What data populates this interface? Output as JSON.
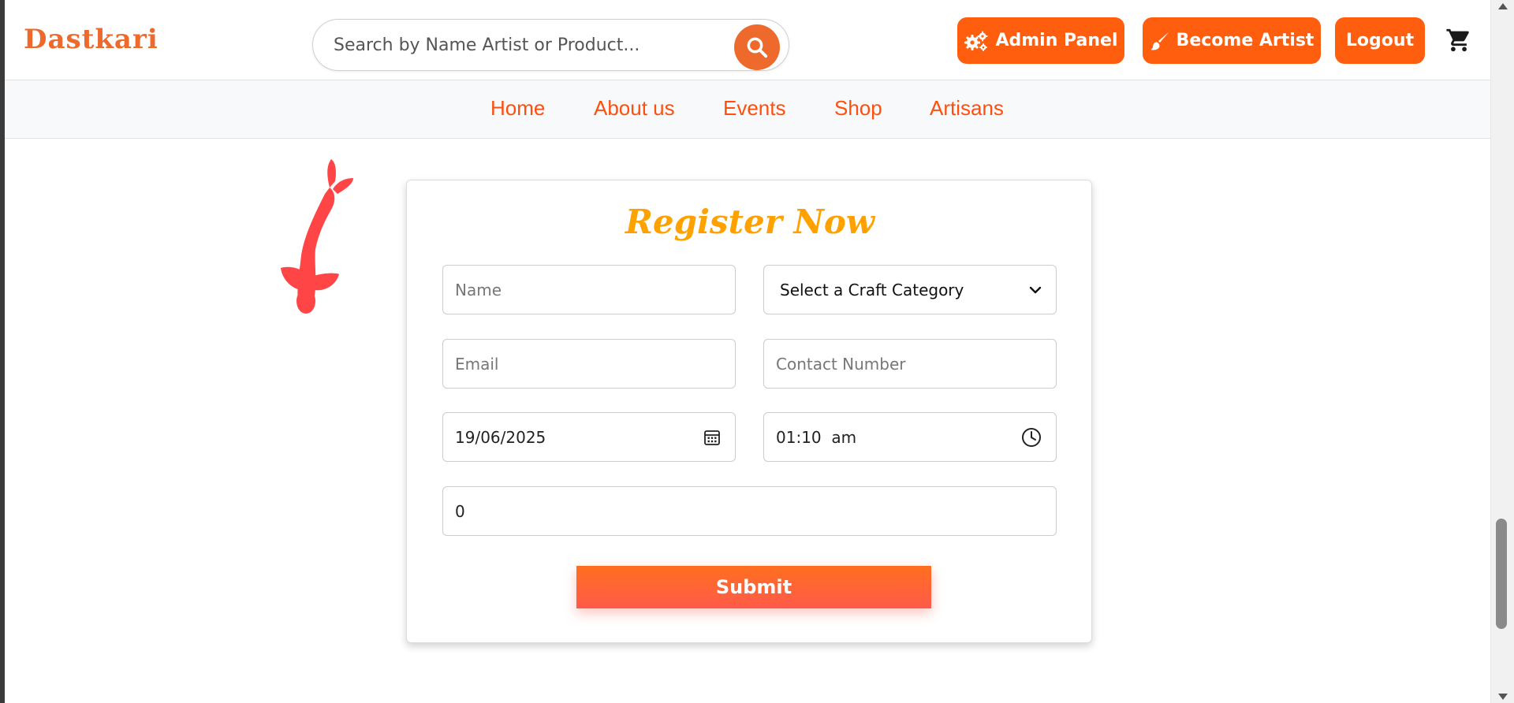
{
  "header": {
    "logo": "Dastkari",
    "search_placeholder": "Search by Name Artist or Product...",
    "admin_label": "Admin Panel",
    "artist_label": "Become Artist",
    "logout_label": "Logout"
  },
  "nav": {
    "items": [
      "Home",
      "About us",
      "Events",
      "Shop",
      "Artisans"
    ]
  },
  "form": {
    "title": "Register Now",
    "name_placeholder": "Name",
    "category_selected": "Select a Craft Category",
    "email_placeholder": "Email",
    "phone_placeholder": "Contact Number",
    "date_value": "19/06/2025",
    "time_value": "01:10  am",
    "quantity_value": "0",
    "submit_label": "Submit"
  },
  "colors": {
    "brand_orange": "#ff5e0e",
    "title_gold": "#ffa200",
    "fish_red": "#ff4545"
  },
  "icons": [
    "search-icon",
    "gears-icon",
    "paint-brush-icon",
    "cart-icon",
    "calendar-icon",
    "clock-icon",
    "chevron-down-icon",
    "koi-fish-icon"
  ]
}
